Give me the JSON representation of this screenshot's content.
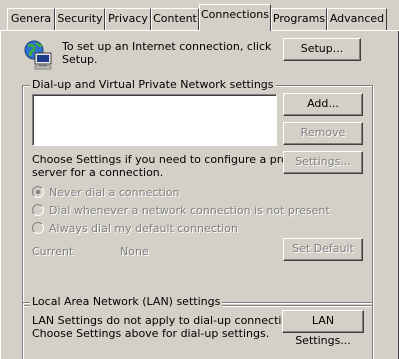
{
  "tabs": [
    {
      "label": "Genera",
      "active": false
    },
    {
      "label": "Security",
      "active": false
    },
    {
      "label": "Privacy",
      "active": false
    },
    {
      "label": "Content",
      "active": false
    },
    {
      "label": "Connections",
      "active": true
    },
    {
      "label": "Programs",
      "active": false
    },
    {
      "label": "Advanced",
      "active": false
    }
  ],
  "setup": {
    "text_line1": "To set up an Internet connection, click",
    "text_line2": "Setup.",
    "button": "Setup..."
  },
  "dialup": {
    "group_title": "Dial-up and Virtual Private Network settings",
    "add_button": "Add...",
    "remove_button": "Remove",
    "settings_text_line1": "Choose Settings if you need to configure a proxy",
    "settings_text_line2": "server for a connection.",
    "settings_button": "Settings...",
    "radio_options": [
      {
        "label": "Never dial a connection",
        "selected": true
      },
      {
        "label": "Dial whenever a network connection is not present",
        "selected": false
      },
      {
        "label": "Always dial my default connection",
        "selected": false
      }
    ],
    "current_label": "Current",
    "current_value": "None",
    "set_default_button": "Set Default"
  },
  "lan": {
    "group_title": "Local Area Network (LAN) settings",
    "text_line1": "LAN Settings do not apply to dial-up connections.",
    "text_line2": "Choose Settings above for dial-up settings.",
    "button": "LAN Settings..."
  }
}
